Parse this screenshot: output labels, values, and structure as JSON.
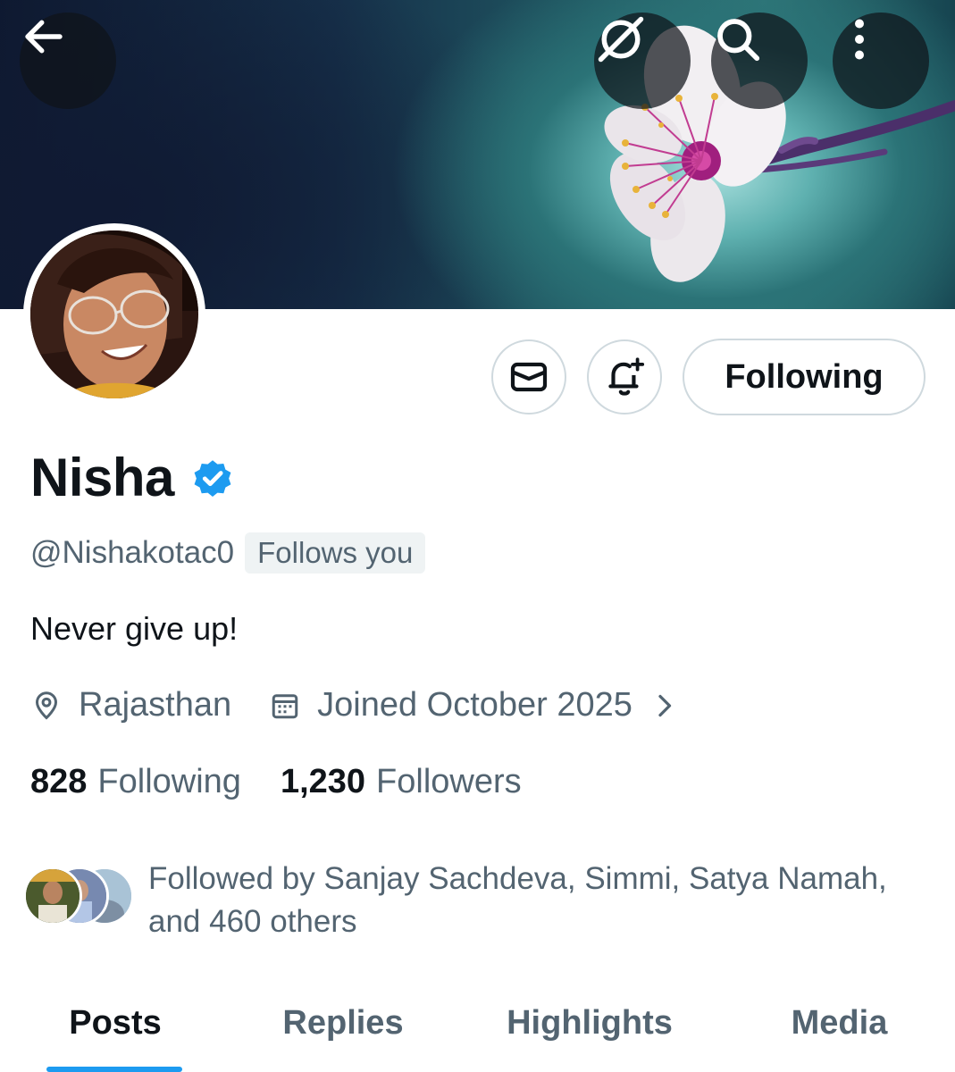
{
  "header": {
    "back_icon": "arrow-left-icon",
    "actions": [
      {
        "icon": "grok-icon"
      },
      {
        "icon": "search-icon"
      },
      {
        "icon": "more-vertical-icon"
      }
    ]
  },
  "profile": {
    "name": "Nisha",
    "verified": true,
    "verified_color": "#1d9bf0",
    "handle": "@Nishakotac0",
    "follows_you_label": "Follows you",
    "bio": "Never give up!",
    "location": "Rajasthan",
    "joined": "Joined October 2025",
    "following_count": "828",
    "following_label": "Following",
    "followers_count": "1,230",
    "followers_label": "Followers",
    "followed_by_text": "Followed by Sanjay Sachdeva, Simmi, Satya Namah, and 460 others"
  },
  "actions": {
    "message_icon": "mail-icon",
    "notify_icon": "bell-plus-icon",
    "follow_button_label": "Following"
  },
  "tabs": [
    {
      "label": "Posts",
      "active": true
    },
    {
      "label": "Replies",
      "active": false
    },
    {
      "label": "Highlights",
      "active": false
    },
    {
      "label": "Media",
      "active": false
    }
  ],
  "colors": {
    "accent": "#1d9bf0",
    "text_primary": "#0f1419",
    "text_secondary": "#536471",
    "border": "#cfd9de"
  }
}
